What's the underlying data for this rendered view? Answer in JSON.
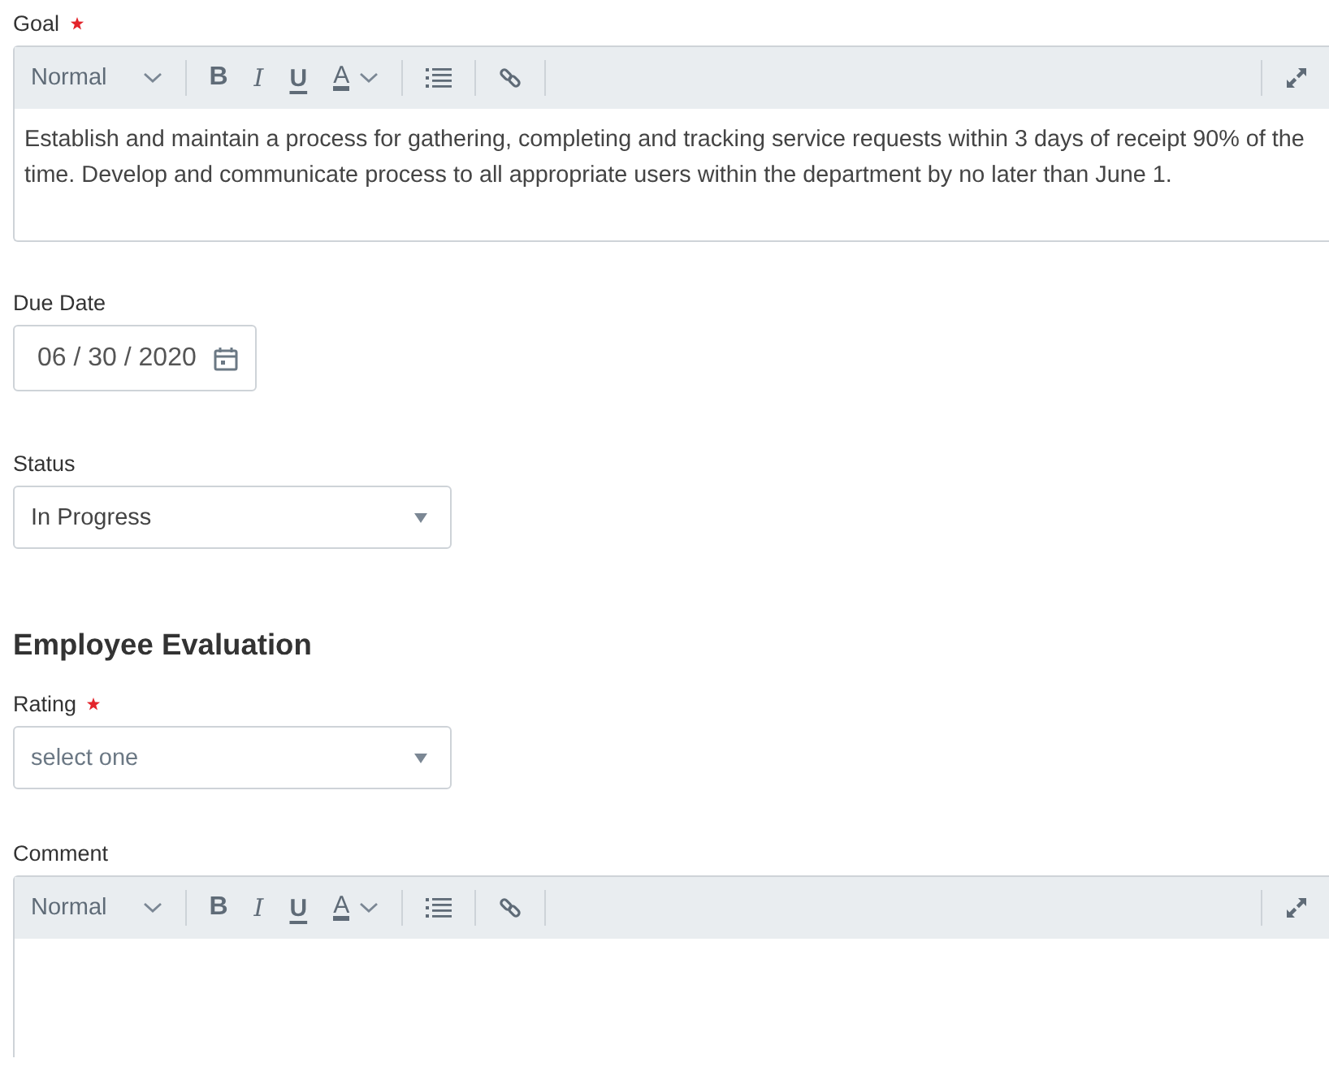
{
  "goal": {
    "label": "Goal",
    "required": true,
    "toolbar": [
      {
        "kind": "format",
        "label": "Normal"
      },
      {
        "kind": "bold",
        "label": "B"
      },
      {
        "kind": "italic",
        "label": "I"
      },
      {
        "kind": "underline",
        "label": "U"
      },
      {
        "kind": "color",
        "label": "A"
      },
      {
        "kind": "list"
      },
      {
        "kind": "link"
      },
      {
        "kind": "expand"
      }
    ],
    "value": "Establish and maintain a process for gathering, completing and tracking service requests within 3 days of receipt 90% of the time. Develop and communicate process to all appropriate users within the department by no later than June 1."
  },
  "due_date": {
    "label": "Due Date",
    "value": "06 / 30 / 2020"
  },
  "status": {
    "label": "Status",
    "value": "In Progress"
  },
  "section_heading": "Employee Evaluation",
  "rating": {
    "label": "Rating",
    "required": true,
    "placeholder": "select one"
  },
  "comment": {
    "label": "Comment",
    "required": false,
    "toolbar": [
      {
        "kind": "format",
        "label": "Normal"
      },
      {
        "kind": "bold",
        "label": "B"
      },
      {
        "kind": "italic",
        "label": "I"
      },
      {
        "kind": "underline",
        "label": "U"
      },
      {
        "kind": "color",
        "label": "A"
      },
      {
        "kind": "list"
      },
      {
        "kind": "link"
      },
      {
        "kind": "expand"
      }
    ]
  }
}
